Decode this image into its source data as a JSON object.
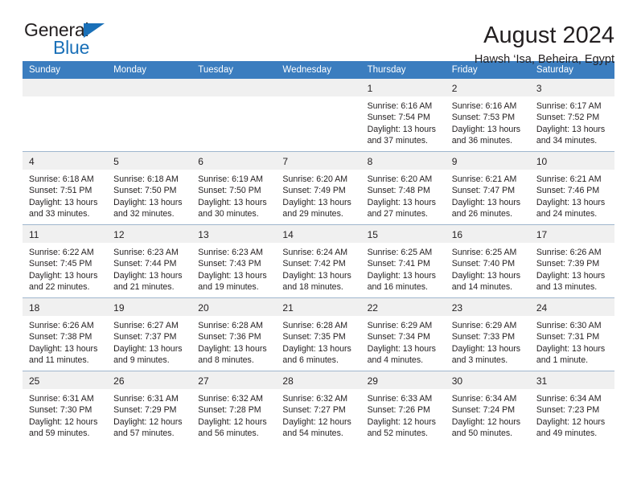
{
  "brand": {
    "name_part1": "General",
    "name_part2": "Blue",
    "accent_color": "#1a70b8"
  },
  "header": {
    "title": "August 2024",
    "subtitle": "Hawsh ‘Isa, Beheira, Egypt"
  },
  "calendar": {
    "header_bg": "#3b7dbf",
    "daynum_bg": "#f0f0f0",
    "weekday_headers": [
      "Sunday",
      "Monday",
      "Tuesday",
      "Wednesday",
      "Thursday",
      "Friday",
      "Saturday"
    ],
    "weeks": [
      [
        {
          "day": "",
          "blank": true
        },
        {
          "day": "",
          "blank": true
        },
        {
          "day": "",
          "blank": true
        },
        {
          "day": "",
          "blank": true
        },
        {
          "day": "1",
          "sunrise": "Sunrise: 6:16 AM",
          "sunset": "Sunset: 7:54 PM",
          "daylight_line1": "Daylight: 13 hours",
          "daylight_line2": "and 37 minutes."
        },
        {
          "day": "2",
          "sunrise": "Sunrise: 6:16 AM",
          "sunset": "Sunset: 7:53 PM",
          "daylight_line1": "Daylight: 13 hours",
          "daylight_line2": "and 36 minutes."
        },
        {
          "day": "3",
          "sunrise": "Sunrise: 6:17 AM",
          "sunset": "Sunset: 7:52 PM",
          "daylight_line1": "Daylight: 13 hours",
          "daylight_line2": "and 34 minutes."
        }
      ],
      [
        {
          "day": "4",
          "sunrise": "Sunrise: 6:18 AM",
          "sunset": "Sunset: 7:51 PM",
          "daylight_line1": "Daylight: 13 hours",
          "daylight_line2": "and 33 minutes."
        },
        {
          "day": "5",
          "sunrise": "Sunrise: 6:18 AM",
          "sunset": "Sunset: 7:50 PM",
          "daylight_line1": "Daylight: 13 hours",
          "daylight_line2": "and 32 minutes."
        },
        {
          "day": "6",
          "sunrise": "Sunrise: 6:19 AM",
          "sunset": "Sunset: 7:50 PM",
          "daylight_line1": "Daylight: 13 hours",
          "daylight_line2": "and 30 minutes."
        },
        {
          "day": "7",
          "sunrise": "Sunrise: 6:20 AM",
          "sunset": "Sunset: 7:49 PM",
          "daylight_line1": "Daylight: 13 hours",
          "daylight_line2": "and 29 minutes."
        },
        {
          "day": "8",
          "sunrise": "Sunrise: 6:20 AM",
          "sunset": "Sunset: 7:48 PM",
          "daylight_line1": "Daylight: 13 hours",
          "daylight_line2": "and 27 minutes."
        },
        {
          "day": "9",
          "sunrise": "Sunrise: 6:21 AM",
          "sunset": "Sunset: 7:47 PM",
          "daylight_line1": "Daylight: 13 hours",
          "daylight_line2": "and 26 minutes."
        },
        {
          "day": "10",
          "sunrise": "Sunrise: 6:21 AM",
          "sunset": "Sunset: 7:46 PM",
          "daylight_line1": "Daylight: 13 hours",
          "daylight_line2": "and 24 minutes."
        }
      ],
      [
        {
          "day": "11",
          "sunrise": "Sunrise: 6:22 AM",
          "sunset": "Sunset: 7:45 PM",
          "daylight_line1": "Daylight: 13 hours",
          "daylight_line2": "and 22 minutes."
        },
        {
          "day": "12",
          "sunrise": "Sunrise: 6:23 AM",
          "sunset": "Sunset: 7:44 PM",
          "daylight_line1": "Daylight: 13 hours",
          "daylight_line2": "and 21 minutes."
        },
        {
          "day": "13",
          "sunrise": "Sunrise: 6:23 AM",
          "sunset": "Sunset: 7:43 PM",
          "daylight_line1": "Daylight: 13 hours",
          "daylight_line2": "and 19 minutes."
        },
        {
          "day": "14",
          "sunrise": "Sunrise: 6:24 AM",
          "sunset": "Sunset: 7:42 PM",
          "daylight_line1": "Daylight: 13 hours",
          "daylight_line2": "and 18 minutes."
        },
        {
          "day": "15",
          "sunrise": "Sunrise: 6:25 AM",
          "sunset": "Sunset: 7:41 PM",
          "daylight_line1": "Daylight: 13 hours",
          "daylight_line2": "and 16 minutes."
        },
        {
          "day": "16",
          "sunrise": "Sunrise: 6:25 AM",
          "sunset": "Sunset: 7:40 PM",
          "daylight_line1": "Daylight: 13 hours",
          "daylight_line2": "and 14 minutes."
        },
        {
          "day": "17",
          "sunrise": "Sunrise: 6:26 AM",
          "sunset": "Sunset: 7:39 PM",
          "daylight_line1": "Daylight: 13 hours",
          "daylight_line2": "and 13 minutes."
        }
      ],
      [
        {
          "day": "18",
          "sunrise": "Sunrise: 6:26 AM",
          "sunset": "Sunset: 7:38 PM",
          "daylight_line1": "Daylight: 13 hours",
          "daylight_line2": "and 11 minutes."
        },
        {
          "day": "19",
          "sunrise": "Sunrise: 6:27 AM",
          "sunset": "Sunset: 7:37 PM",
          "daylight_line1": "Daylight: 13 hours",
          "daylight_line2": "and 9 minutes."
        },
        {
          "day": "20",
          "sunrise": "Sunrise: 6:28 AM",
          "sunset": "Sunset: 7:36 PM",
          "daylight_line1": "Daylight: 13 hours",
          "daylight_line2": "and 8 minutes."
        },
        {
          "day": "21",
          "sunrise": "Sunrise: 6:28 AM",
          "sunset": "Sunset: 7:35 PM",
          "daylight_line1": "Daylight: 13 hours",
          "daylight_line2": "and 6 minutes."
        },
        {
          "day": "22",
          "sunrise": "Sunrise: 6:29 AM",
          "sunset": "Sunset: 7:34 PM",
          "daylight_line1": "Daylight: 13 hours",
          "daylight_line2": "and 4 minutes."
        },
        {
          "day": "23",
          "sunrise": "Sunrise: 6:29 AM",
          "sunset": "Sunset: 7:33 PM",
          "daylight_line1": "Daylight: 13 hours",
          "daylight_line2": "and 3 minutes."
        },
        {
          "day": "24",
          "sunrise": "Sunrise: 6:30 AM",
          "sunset": "Sunset: 7:31 PM",
          "daylight_line1": "Daylight: 13 hours",
          "daylight_line2": "and 1 minute."
        }
      ],
      [
        {
          "day": "25",
          "sunrise": "Sunrise: 6:31 AM",
          "sunset": "Sunset: 7:30 PM",
          "daylight_line1": "Daylight: 12 hours",
          "daylight_line2": "and 59 minutes."
        },
        {
          "day": "26",
          "sunrise": "Sunrise: 6:31 AM",
          "sunset": "Sunset: 7:29 PM",
          "daylight_line1": "Daylight: 12 hours",
          "daylight_line2": "and 57 minutes."
        },
        {
          "day": "27",
          "sunrise": "Sunrise: 6:32 AM",
          "sunset": "Sunset: 7:28 PM",
          "daylight_line1": "Daylight: 12 hours",
          "daylight_line2": "and 56 minutes."
        },
        {
          "day": "28",
          "sunrise": "Sunrise: 6:32 AM",
          "sunset": "Sunset: 7:27 PM",
          "daylight_line1": "Daylight: 12 hours",
          "daylight_line2": "and 54 minutes."
        },
        {
          "day": "29",
          "sunrise": "Sunrise: 6:33 AM",
          "sunset": "Sunset: 7:26 PM",
          "daylight_line1": "Daylight: 12 hours",
          "daylight_line2": "and 52 minutes."
        },
        {
          "day": "30",
          "sunrise": "Sunrise: 6:34 AM",
          "sunset": "Sunset: 7:24 PM",
          "daylight_line1": "Daylight: 12 hours",
          "daylight_line2": "and 50 minutes."
        },
        {
          "day": "31",
          "sunrise": "Sunrise: 6:34 AM",
          "sunset": "Sunset: 7:23 PM",
          "daylight_line1": "Daylight: 12 hours",
          "daylight_line2": "and 49 minutes."
        }
      ]
    ]
  }
}
